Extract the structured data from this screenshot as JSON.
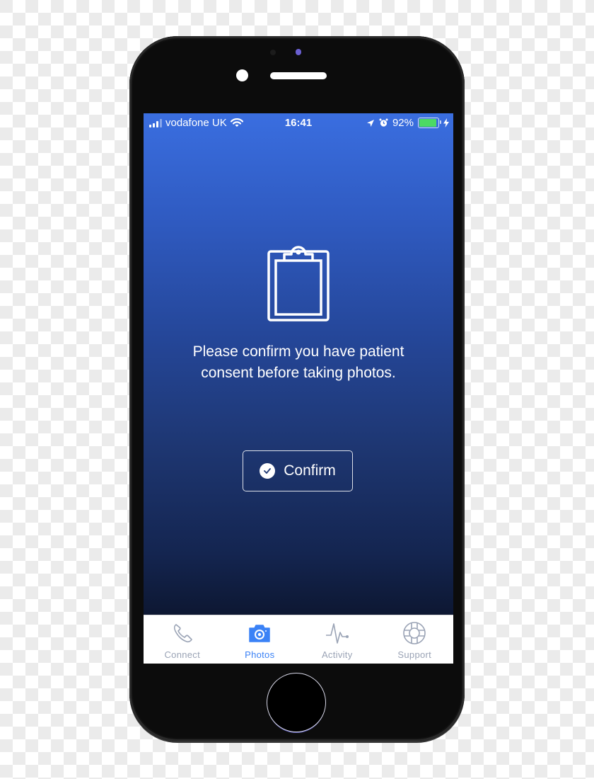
{
  "status_bar": {
    "carrier": "vodafone UK",
    "time": "16:41",
    "battery_percent_label": "92%",
    "battery_level": 0.92,
    "signal_bars_filled": 3,
    "signal_bars_total": 4,
    "icons": [
      "signal-icon",
      "wifi-icon",
      "location-arrow-icon",
      "alarm-icon",
      "battery-icon",
      "charging-bolt-icon"
    ]
  },
  "main": {
    "icon": "clipboard-icon",
    "message": "Please confirm you have patient consent before taking photos.",
    "confirm_button": {
      "label": "Confirm",
      "icon": "check-circle-icon"
    }
  },
  "tab_bar": {
    "tabs": [
      {
        "label": "Connect",
        "icon": "phone-icon",
        "active": false
      },
      {
        "label": "Photos",
        "icon": "camera-icon",
        "active": true
      },
      {
        "label": "Activity",
        "icon": "pulse-icon",
        "active": false
      },
      {
        "label": "Support",
        "icon": "lifebuoy-icon",
        "active": false
      }
    ]
  },
  "colors": {
    "accent": "#3b82f6",
    "inactive_tab": "#9aa3b5",
    "gradient_top": "#3a6ee0",
    "gradient_bottom": "#070c1a",
    "battery": "#4cd964"
  }
}
